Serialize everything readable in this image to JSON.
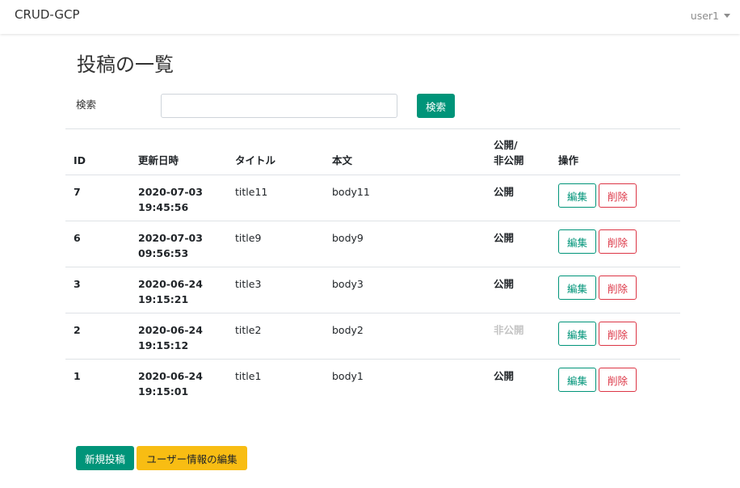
{
  "navbar": {
    "brand": "CRUD-GCP",
    "user": "user1"
  },
  "page": {
    "title": "投稿の一覧"
  },
  "search": {
    "label": "検索",
    "placeholder": "",
    "value": "",
    "button": "検索"
  },
  "table": {
    "headers": {
      "id": "ID",
      "updated": "更新日時",
      "title": "タイトル",
      "body": "本文",
      "public_line1": "公開/",
      "public_line2": "非公開",
      "actions": "操作"
    },
    "rows": [
      {
        "id": "7",
        "date": "2020-07-03",
        "time": "19:45:56",
        "title": "title11",
        "body": "body11",
        "status": "公開",
        "edit": "編集",
        "delete": "削除"
      },
      {
        "id": "6",
        "date": "2020-07-03",
        "time": "09:56:53",
        "title": "title9",
        "body": "body9",
        "status": "公開",
        "edit": "編集",
        "delete": "削除"
      },
      {
        "id": "3",
        "date": "2020-06-24",
        "time": "19:15:21",
        "title": "title3",
        "body": "body3",
        "status": "公開",
        "edit": "編集",
        "delete": "削除"
      },
      {
        "id": "2",
        "date": "2020-06-24",
        "time": "19:15:12",
        "title": "title2",
        "body": "body2",
        "status": "非公開",
        "edit": "編集",
        "delete": "削除"
      },
      {
        "id": "1",
        "date": "2020-06-24",
        "time": "19:15:01",
        "title": "title1",
        "body": "body1",
        "status": "公開",
        "edit": "編集",
        "delete": "削除"
      }
    ]
  },
  "footer": {
    "new_post": "新規投稿",
    "edit_user": "ユーザー情報の編集"
  },
  "colors": {
    "teal": "#009479",
    "danger": "#dc3545",
    "warning": "#f8bd13",
    "muted": "#c4c4c4"
  }
}
